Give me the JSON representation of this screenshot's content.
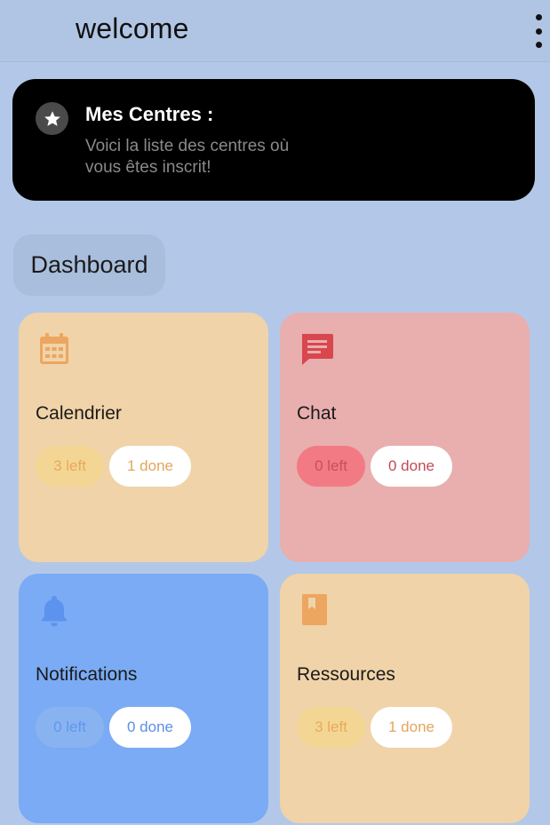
{
  "appbar": {
    "title": "welcome",
    "menu_icon": "more-vert-icon"
  },
  "banner": {
    "icon": "star-icon",
    "title": "Mes Centres :",
    "subtitle": "Voici la liste des centres où vous êtes inscrit!"
  },
  "dashboard": {
    "label": "Dashboard"
  },
  "cards": [
    {
      "title": "Calendrier",
      "icon": "calendar-icon",
      "left": "3 left",
      "done": "1 done",
      "color": "#f0d3a8"
    },
    {
      "title": "Chat",
      "icon": "chat-icon",
      "left": "0 left",
      "done": "0 done",
      "color": "#e9aeae"
    },
    {
      "title": "Notifications",
      "icon": "bell-icon",
      "left": "0 left",
      "done": "0 done",
      "color": "#7aabf4"
    },
    {
      "title": "Ressources",
      "icon": "book-icon",
      "left": "3 left",
      "done": "1 done",
      "color": "#f0d3a8"
    }
  ]
}
